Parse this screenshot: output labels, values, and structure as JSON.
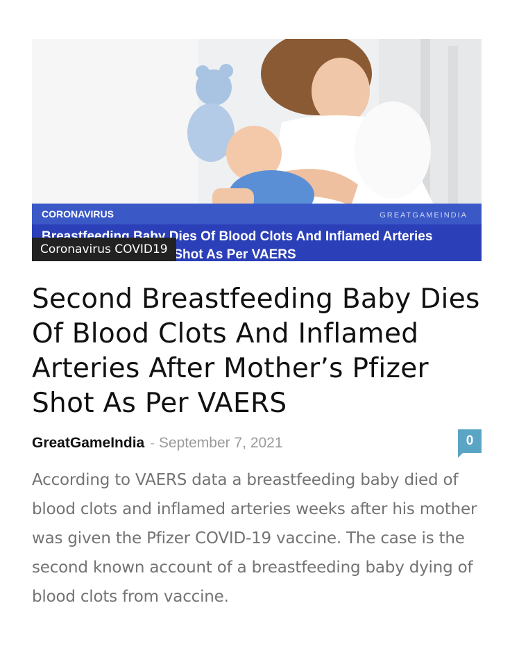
{
  "article": {
    "category": "Coronavirus COVID19",
    "title": "Second Breastfeeding Baby Dies Of Blood Clots And Inflamed Arteries After Mother’s Pfizer Shot As Per VAERS",
    "author": "GreatGameIndia",
    "separator": "-",
    "date": "September 7, 2021",
    "comment_count": "0",
    "excerpt": "According to VAERS data a breastfeeding baby died of blood clots and inflamed arteries weeks after his mother was given the Pfizer COVID-19 vaccine. The case is the second known account of a breastfeeding baby dying of blood clots from vaccine."
  },
  "image_overlay": {
    "tag": "CORONAVIRUS",
    "brand": "GREATGAMEINDIA",
    "headline_line1": "Breastfeeding Baby Dies Of Blood Clots And Inflamed Arteries",
    "headline_line2": "After Mother's Pfizer Shot As Per VAERS"
  },
  "colors": {
    "banner_blue": "#2b3fb8",
    "banner_top_blue": "#3a59c7",
    "comment_badge": "#5ba5c4",
    "category_badge_bg": "#222222"
  }
}
